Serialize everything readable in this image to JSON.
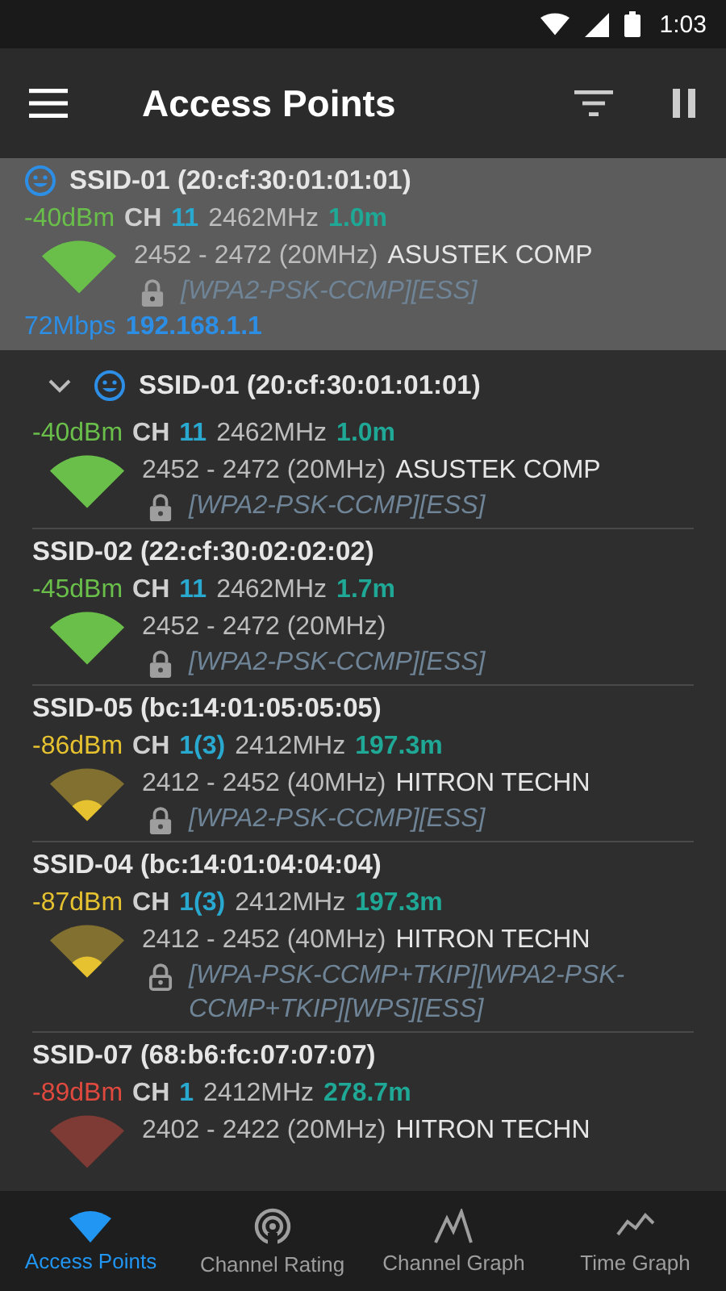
{
  "status_bar": {
    "time": "1:03"
  },
  "app_bar": {
    "title": "Access Points"
  },
  "connected": {
    "ssid": "SSID-01 (20:cf:30:01:01:01)",
    "dbm": "-40dBm",
    "color": "#6abf4b",
    "ch_label": "CH",
    "channel": "11",
    "freq": "2462MHz",
    "distance": "1.0m",
    "range": "2452 - 2472 (20MHz)",
    "vendor": "ASUSTEK COMP",
    "lock_outlined": false,
    "security": "[WPA2-PSK-CCMP][ESS]",
    "rate": "72Mbps",
    "ip": "192.168.1.1"
  },
  "group": {
    "expanded": true,
    "ssid": "SSID-01 (20:cf:30:01:01:01)",
    "dbm": "-40dBm",
    "color": "#6abf4b",
    "ch_label": "CH",
    "channel": "11",
    "freq": "2462MHz",
    "distance": "1.0m",
    "range": "2452 - 2472 (20MHz)",
    "vendor": "ASUSTEK COMP",
    "lock_outlined": false,
    "security": "[WPA2-PSK-CCMP][ESS]"
  },
  "access_points": [
    {
      "ssid": "SSID-02 (22:cf:30:02:02:02)",
      "dbm": "-45dBm",
      "color": "#6abf4b",
      "ch_label": "CH",
      "channel": "11",
      "freq": "2462MHz",
      "distance": "1.7m",
      "range": "2452 - 2472 (20MHz)",
      "lock_outlined": false,
      "security": "[WPA2-PSK-CCMP][ESS]"
    },
    {
      "ssid": "SSID-05 (bc:14:01:05:05:05)",
      "dbm": "-86dBm",
      "color": "#e6c230",
      "ch_label": "CH",
      "channel": "1(3)",
      "freq": "2412MHz",
      "distance": "197.3m",
      "range": "2412 - 2452 (40MHz)",
      "vendor": "HITRON TECHN",
      "lock_outlined": false,
      "security": "[WPA2-PSK-CCMP][ESS]"
    },
    {
      "ssid": "SSID-04 (bc:14:01:04:04:04)",
      "dbm": "-87dBm",
      "color": "#e6c230",
      "ch_label": "CH",
      "channel": "1(3)",
      "freq": "2412MHz",
      "distance": "197.3m",
      "range": "2412 - 2452 (40MHz)",
      "vendor": "HITRON TECHN",
      "lock_outlined": true,
      "security": "[WPA-PSK-CCMP+TKIP][WPA2-PSK-CCMP+TKIP][WPS][ESS]"
    },
    {
      "ssid": "SSID-07 (68:b6:fc:07:07:07)",
      "dbm": "-89dBm",
      "color": "#e0493e",
      "ch_label": "CH",
      "channel": "1",
      "freq": "2412MHz",
      "distance": "278.7m",
      "range": "2402 - 2422 (20MHz)",
      "vendor": "HITRON TECHN"
    }
  ],
  "bottom_nav": [
    {
      "label": "Access Points",
      "selected": true,
      "kind": "wifi"
    },
    {
      "label": "Channel Rating",
      "selected": false,
      "kind": "rating"
    },
    {
      "label": "Channel Graph",
      "selected": false,
      "kind": "graph"
    },
    {
      "label": "Time Graph",
      "selected": false,
      "kind": "time"
    }
  ]
}
